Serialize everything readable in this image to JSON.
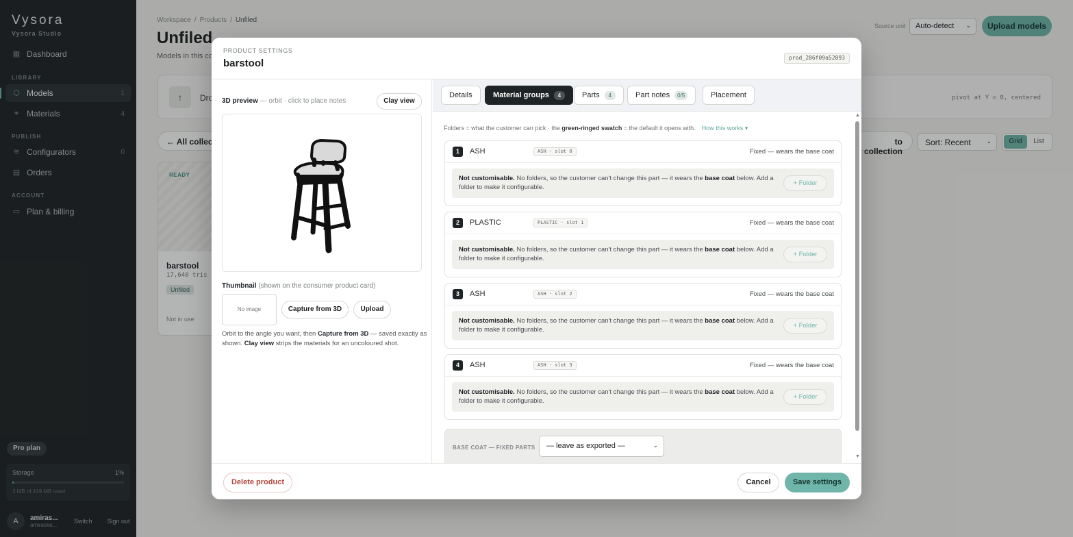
{
  "sidebar": {
    "brand": "Vysora",
    "brand_sub": "Vysora Studio",
    "dashboard": "Dashboard",
    "sections": {
      "library": "LIBRARY",
      "publish": "PUBLISH",
      "account": "ACCOUNT"
    },
    "items": [
      {
        "label": "Models",
        "count": "1",
        "icon": "cube-icon"
      },
      {
        "label": "Materials",
        "count": "4",
        "icon": "materials-icon"
      },
      {
        "label": "Configurators",
        "count": "0",
        "icon": "layers-icon"
      },
      {
        "label": "Orders",
        "count": "",
        "icon": "receipt-icon"
      },
      {
        "label": "Plan & billing",
        "count": "",
        "icon": "card-icon"
      }
    ],
    "plan": "Pro plan",
    "storage": {
      "label": "Storage",
      "percent": "1%",
      "fraction": 0.01,
      "detail": "3 MB of 419 MB used"
    },
    "user": {
      "avatar": "A",
      "name": "amiras...",
      "email": "amiraska...",
      "switch": "Switch",
      "signout": "Sign out"
    }
  },
  "background": {
    "breadcrumb": [
      "Workspace",
      "Products",
      "Unfiled"
    ],
    "title": "Unfiled",
    "subtitle": "Models in this co",
    "source_unit_label": "Source unit",
    "source_unit_value": "Auto-detect",
    "upload_button": "Upload models",
    "drop_text": "Dro",
    "pivot_text": "pivot at Y = 0, centered",
    "all_collections": "All collect",
    "to_collection": "to collection",
    "sort": "Sort: Recent",
    "view": {
      "grid": "Grid",
      "list": "List"
    },
    "card": {
      "status": "READY",
      "name": "barstool",
      "tris": "17,640 tris ·",
      "tag": "Unfiled",
      "usage": "Not in use"
    }
  },
  "modal": {
    "eyebrow": "PRODUCT SETTINGS",
    "title": "barstool",
    "product_id": "prod_286f09a52893",
    "preview": {
      "label": "3D preview",
      "label_hint": "— orbit · click to place notes",
      "clay_button": "Clay view"
    },
    "thumbnail": {
      "label": "Thumbnail",
      "label_hint": "(shown on the consumer product card)",
      "no_image": "No image",
      "capture_button": "Capture from 3D",
      "upload_button": "Upload",
      "hint_1": "Orbit to the angle you want, then ",
      "hint_bold_1": "Capture from 3D",
      "hint_2": " — saved exactly as shown. ",
      "hint_bold_2": "Clay view",
      "hint_3": " strips the materials for an uncoloured shot."
    },
    "tabs": [
      {
        "label": "Details",
        "badge": ""
      },
      {
        "label": "Material groups",
        "badge": "4"
      },
      {
        "label": "Parts",
        "badge": "4"
      },
      {
        "label": "Part notes",
        "badge": "0/5"
      },
      {
        "label": "Placement",
        "badge": ""
      }
    ],
    "intro": {
      "text_1": "Folders = what the customer can pick · the ",
      "bold": "green-ringed swatch",
      "text_2": " = the default it opens with.",
      "how": "How this works ▾"
    },
    "groups": [
      {
        "num": "1",
        "name": "ASH",
        "slot": "ASH · slot 0",
        "status": "Fixed — wears the base coat"
      },
      {
        "num": "2",
        "name": "PLASTIC",
        "slot": "PLASTIC · slot 1",
        "status": "Fixed — wears the base coat"
      },
      {
        "num": "3",
        "name": "ASH",
        "slot": "ASH · slot 2",
        "status": "Fixed — wears the base coat"
      },
      {
        "num": "4",
        "name": "ASH",
        "slot": "ASH · slot 3",
        "status": "Fixed — wears the base coat"
      }
    ],
    "group_msg": {
      "bold": "Not customisable.",
      "text_1": " No folders, so the customer can't change this part — it wears the ",
      "bold_2": "base coat",
      "text_2": " below. Add a folder to make it configurable.",
      "folder_button": "+ Folder"
    },
    "base_coat": {
      "label": "BASE COAT — FIXED PARTS",
      "value": "— leave as exported —"
    },
    "footer": {
      "delete": "Delete product",
      "cancel": "Cancel",
      "save": "Save settings"
    }
  },
  "colors": {
    "accent": "#6fb5aa",
    "sidebar": "#1e2325",
    "danger": "#b3473a"
  }
}
